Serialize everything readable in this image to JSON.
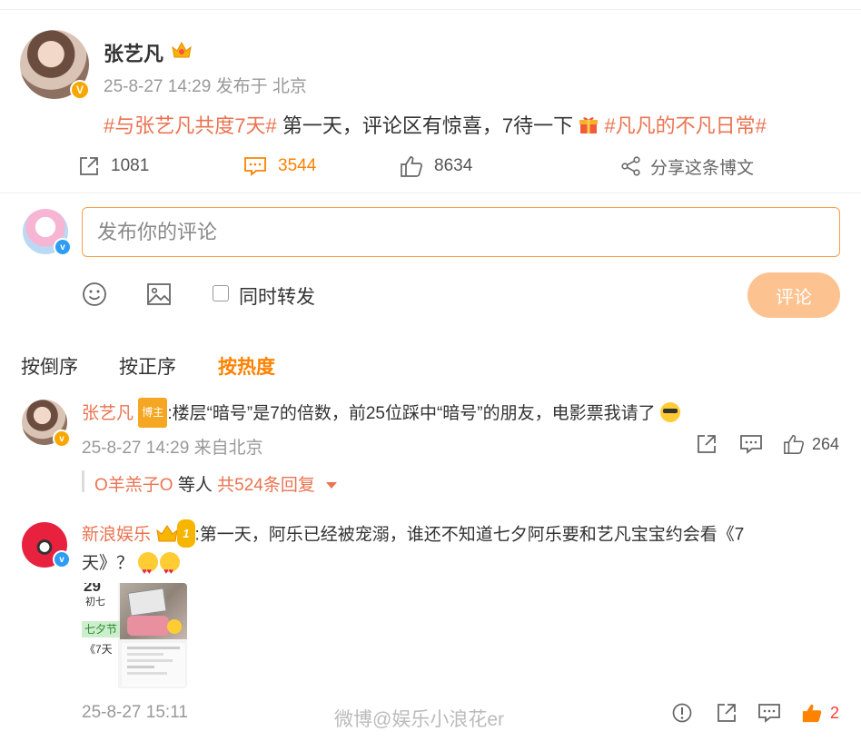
{
  "post": {
    "author": "张艺凡",
    "meta": "25-8-27 14:29 发布于 北京",
    "hashtag1": "#与张艺凡共度7天#",
    "text": " 第一天，评论区有惊喜，7待一下",
    "hashtag2": "#凡凡的不凡日常#"
  },
  "actions": {
    "repost": "1081",
    "comment": "3544",
    "like": "8634",
    "share": "分享这条博文"
  },
  "composer": {
    "placeholder": "发布你的评论",
    "repost_label": "同时转发",
    "submit": "评论"
  },
  "sort": {
    "reverse": "按倒序",
    "forward": "按正序",
    "hot": "按热度"
  },
  "comments": [
    {
      "author": "张艺凡",
      "badge": "博主",
      "text": ":楼层“暗号”是7的倍数，前25位踩中“暗号”的朋友，电影票我请了",
      "meta": "25-8-27 14:29 来自北京",
      "likes": "264",
      "replies_user": "O羊羔子O",
      "replies_suffix": " 等人 ",
      "replies_count": "共524条回复"
    },
    {
      "author": "新浪娱乐",
      "level": "1",
      "text_line1": ":第一天，阿乐已经被宠溺，谁还不知道七夕阿乐要和艺凡宝宝约会看《7",
      "text_line2": "天》？",
      "meta": "25-8-27 15:11",
      "likes": "2",
      "image_text": {
        "day": "29",
        "lunar": "初七",
        "festival": "七夕节",
        "movie": "《7天"
      }
    }
  ],
  "watermark": "微博@娱乐小浪花er",
  "colors": {
    "accent": "#ff8200",
    "hashtag": "#eb7350",
    "submit_bg": "#fcc391",
    "input_border": "#f6a04a"
  }
}
